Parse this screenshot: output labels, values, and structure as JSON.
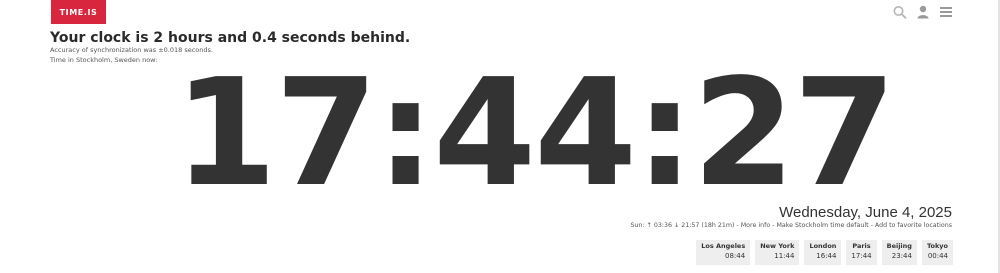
{
  "brand": {
    "logo_text": "TIME.IS",
    "color": "#d7263d"
  },
  "header_icons": [
    "search-icon",
    "user-icon",
    "menu-icon"
  ],
  "status": {
    "headline": "Your clock is 2 hours and 0.4 seconds behind.",
    "accuracy": "Accuracy of synchronization was ±0.018 seconds.",
    "location_now": "Time in Stockholm, Sweden now:"
  },
  "clock": {
    "time": "17:44:27",
    "color": "#333333"
  },
  "date": "Wednesday, June 4, 2025",
  "sun_info": {
    "sun": "Sun: ↑ 03:36 ↓ 21:57 (18h 21m)",
    "more_info": "More info",
    "make_default": "Make Stockholm time default",
    "add_favorite": "Add to favorite locations",
    "separator": " - "
  },
  "cities": [
    {
      "name": "Los Angeles",
      "time": "08:44"
    },
    {
      "name": "New York",
      "time": "11:44"
    },
    {
      "name": "London",
      "time": "16:44"
    },
    {
      "name": "Paris",
      "time": "17:44"
    },
    {
      "name": "Beijing",
      "time": "23:44"
    },
    {
      "name": "Tokyo",
      "time": "00:44"
    }
  ]
}
